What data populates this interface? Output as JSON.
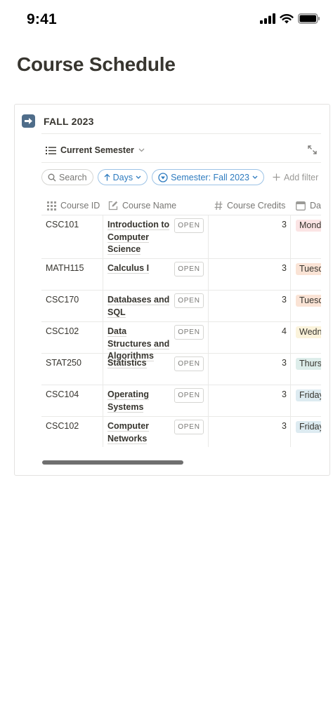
{
  "status": {
    "time": "9:41"
  },
  "page": {
    "title": "Course Schedule"
  },
  "database": {
    "title": "FALL 2023",
    "view_label": "Current Semester",
    "filters": {
      "search": "Search",
      "sort": "Days",
      "semester": "Semester: Fall 2023",
      "add_filter": "Add filter"
    },
    "columns": {
      "course_id": "Course ID",
      "course_name": "Course Name",
      "course_credits": "Course Credits",
      "day": "Day"
    },
    "open_label": "OPEN",
    "rows": [
      {
        "id": "CSC101",
        "name": "Introduction to Computer Science",
        "credits": "3",
        "day": "Monday",
        "day_color": "#fbe4e4"
      },
      {
        "id": "MATH115",
        "name": "Calculus I",
        "credits": "3",
        "day": "Tuesday",
        "day_color": "#fae3d5"
      },
      {
        "id": "CSC170",
        "name": "Databases and SQL",
        "credits": "3",
        "day": "Tuesday",
        "day_color": "#fae3d5"
      },
      {
        "id": "CSC102",
        "name": "Data Structures and Algorithms",
        "credits": "4",
        "day": "Wednesday",
        "day_color": "#fbf3db"
      },
      {
        "id": "STAT250",
        "name": "Statistics",
        "credits": "3",
        "day": "Thursday",
        "day_color": "#ddedea"
      },
      {
        "id": "CSC104",
        "name": "Operating Systems",
        "credits": "3",
        "day": "Friday",
        "day_color": "#ddebf1"
      },
      {
        "id": "CSC102",
        "name": "Computer Networks",
        "credits": "3",
        "day": "Friday",
        "day_color": "#ddebf1"
      }
    ]
  },
  "icons": {
    "signal": "signal-icon",
    "wifi": "wifi-icon",
    "battery": "battery-icon",
    "arrow": "arrow-right-icon",
    "list": "list-icon",
    "expand": "expand-icon",
    "search": "search-icon",
    "sort": "arrow-up-icon",
    "filter": "filter-icon",
    "plus": "plus-icon",
    "grid": "grid-icon",
    "edit": "edit-icon",
    "hash": "hash-icon",
    "calendar": "calendar-icon"
  }
}
